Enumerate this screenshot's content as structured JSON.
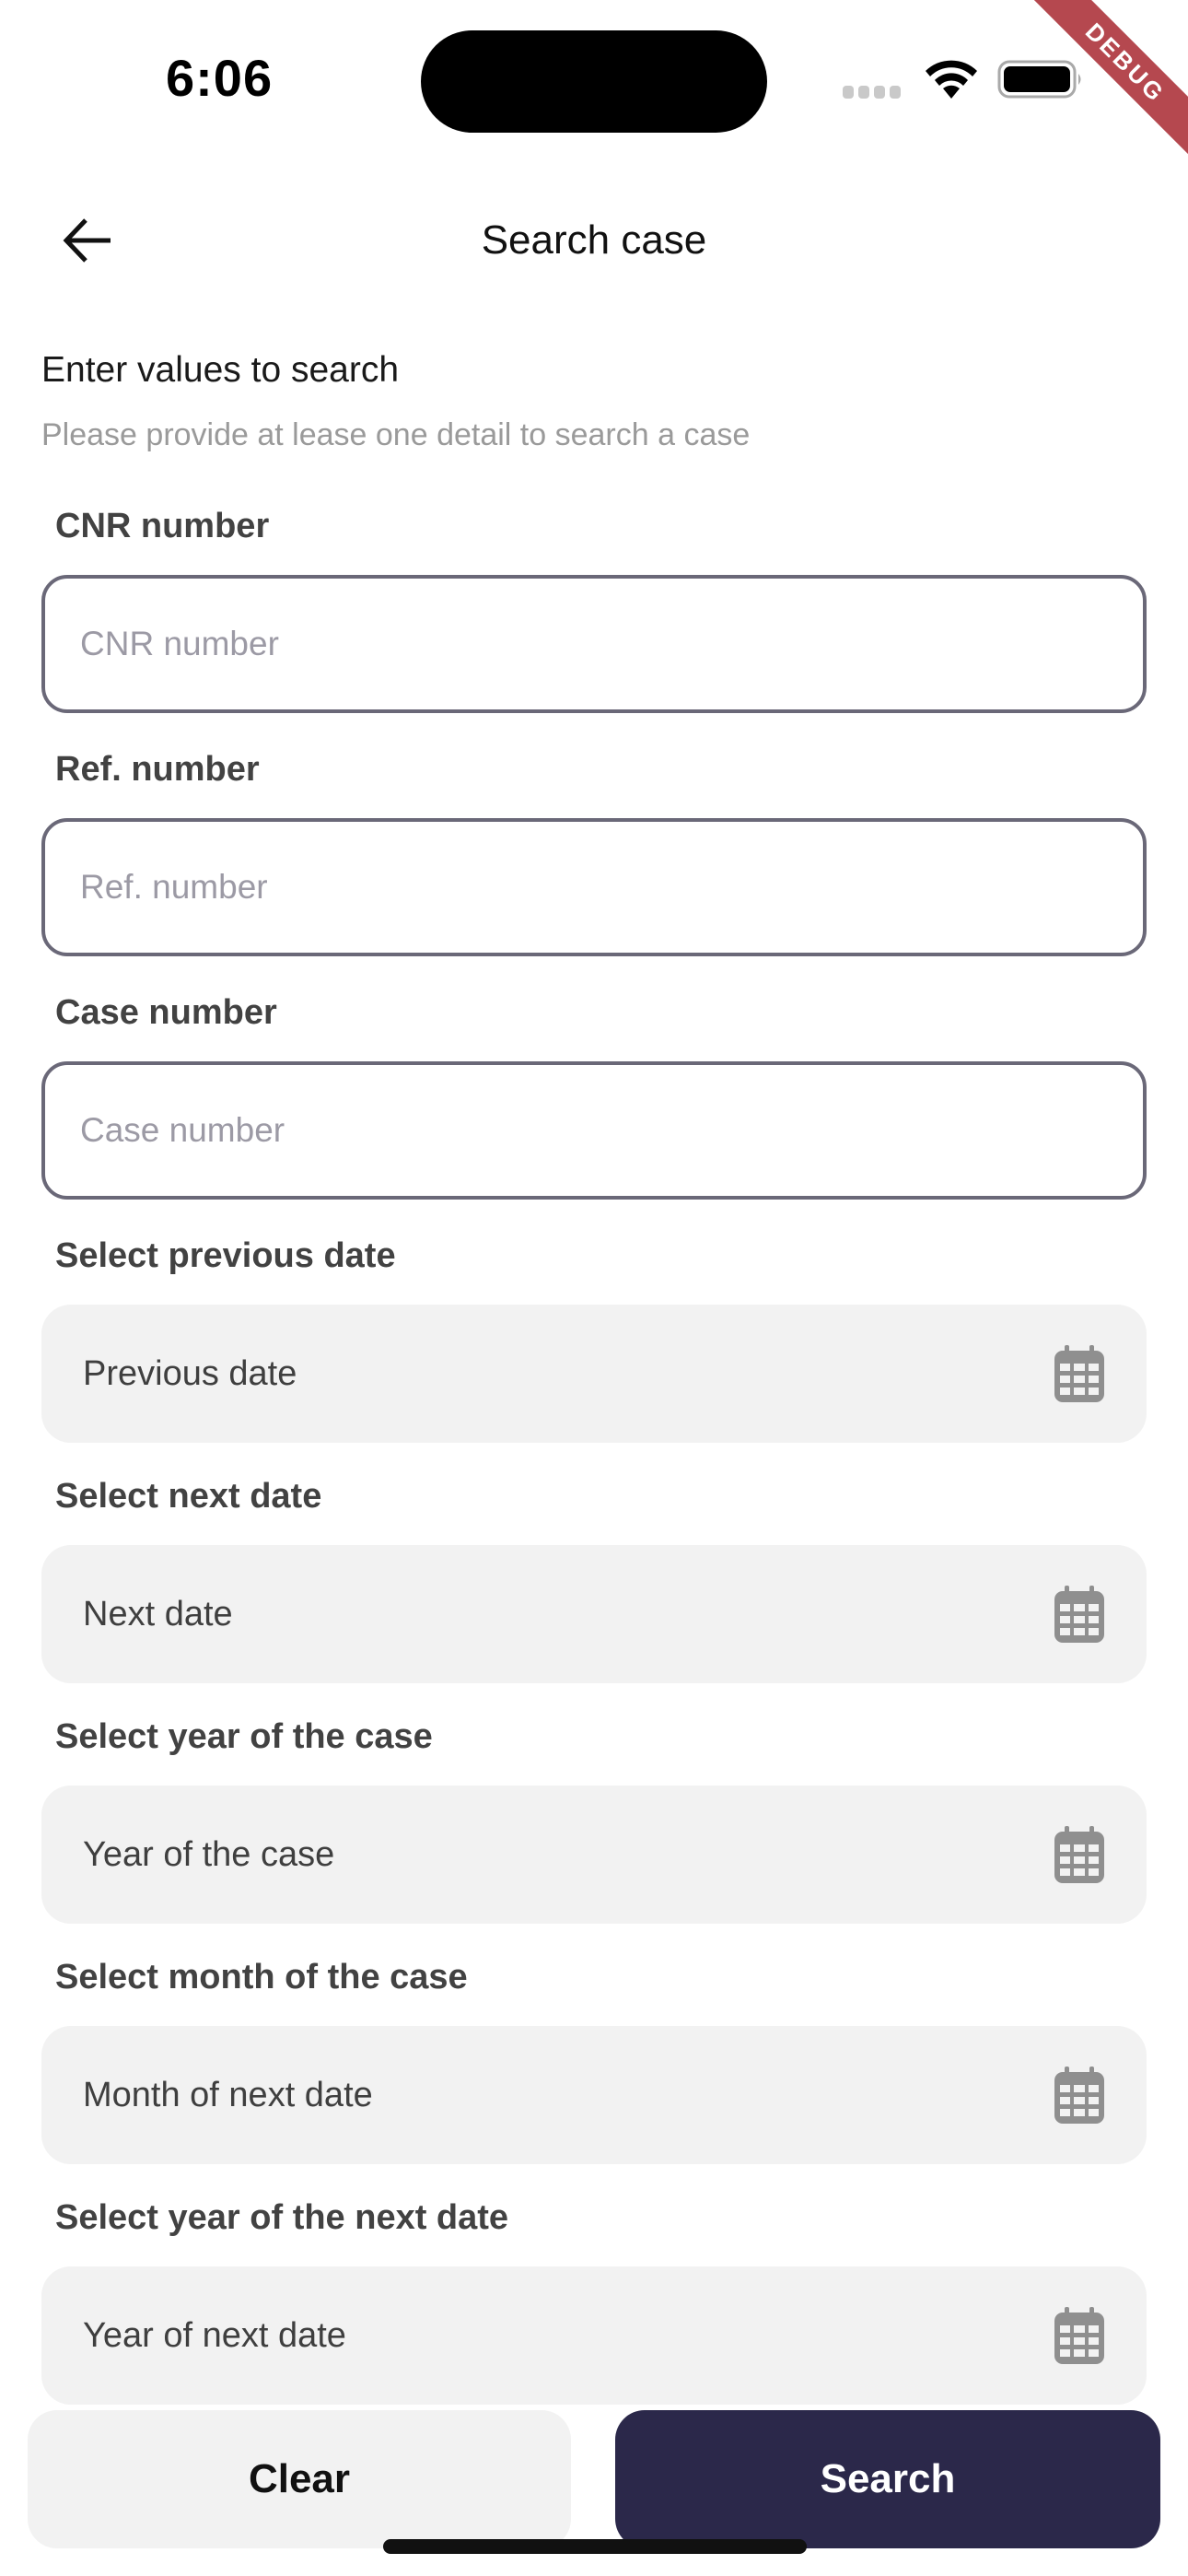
{
  "status_bar": {
    "time": "6:06",
    "debug_label": "DEBUG"
  },
  "app_bar": {
    "title": "Search case",
    "back_icon": "arrow-left-icon"
  },
  "intro": {
    "title": "Enter values to search",
    "subtitle": "Please provide at lease one detail to search a case"
  },
  "text_fields": [
    {
      "label": "CNR number",
      "placeholder": "CNR number",
      "value": ""
    },
    {
      "label": "Ref. number",
      "placeholder": "Ref. number",
      "value": ""
    },
    {
      "label": "Case number",
      "placeholder": "Case number",
      "value": ""
    }
  ],
  "date_fields": [
    {
      "label": "Select previous date",
      "placeholder": "Previous date",
      "icon": "calendar-icon"
    },
    {
      "label": "Select next date",
      "placeholder": "Next date",
      "icon": "calendar-icon"
    },
    {
      "label": "Select year of the case",
      "placeholder": "Year of the case",
      "icon": "calendar-icon"
    },
    {
      "label": "Select month of the case",
      "placeholder": "Month of next date",
      "icon": "calendar-icon"
    },
    {
      "label": "Select year of the next date",
      "placeholder": "Year of next date",
      "icon": "calendar-icon"
    }
  ],
  "actions": {
    "clear_label": "Clear",
    "search_label": "Search"
  },
  "colors": {
    "primary": "#2b284a",
    "input_border": "#6a6878",
    "date_field_bg": "#f2f2f2",
    "debug_ribbon": "#b5484f"
  }
}
